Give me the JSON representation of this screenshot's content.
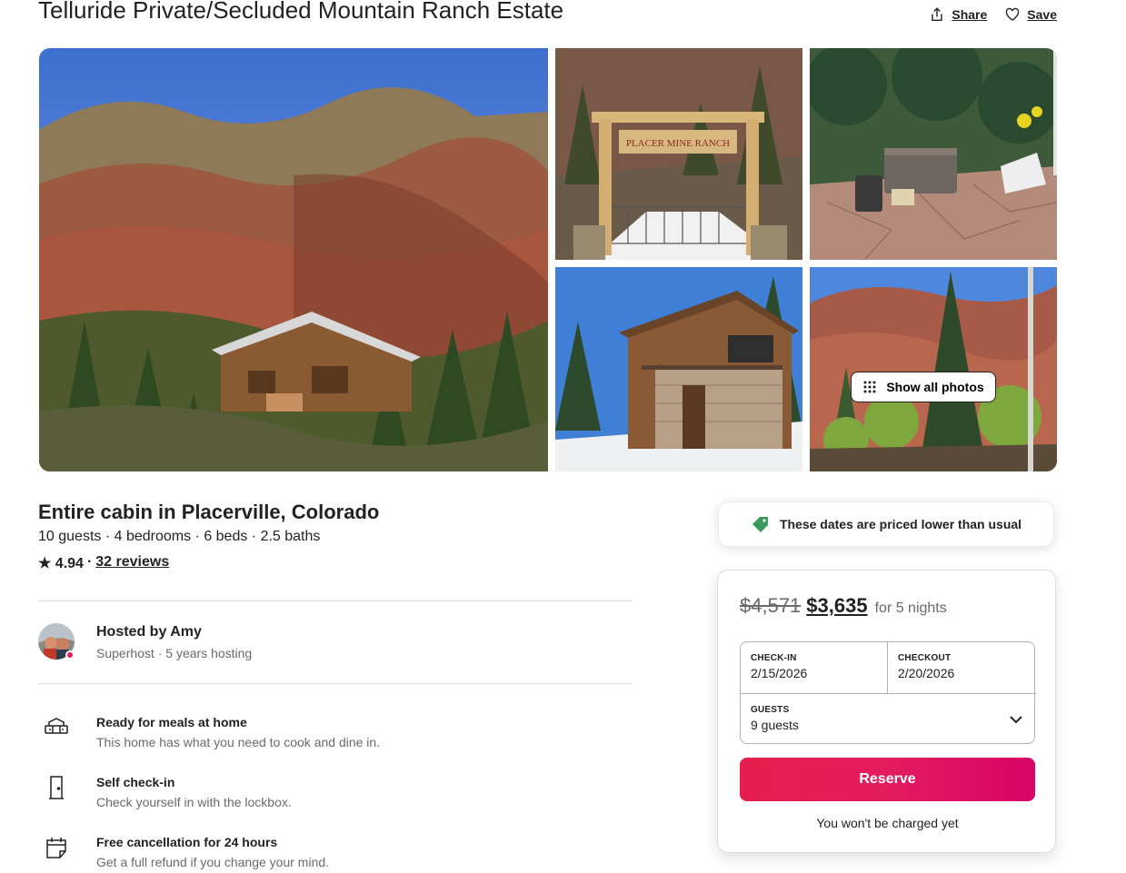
{
  "header": {
    "title": "Telluride Private/Secluded Mountain Ranch Estate",
    "share_label": "Share",
    "save_label": "Save"
  },
  "gallery": {
    "show_all_label": "Show all photos",
    "gate_sign_text": "PLACER MINE RANCH"
  },
  "overview": {
    "listing_type": "Entire cabin in Placerville, Colorado",
    "facts": "10 guests · 4 bedrooms · 6 beds · 2.5 baths",
    "rating": "★ 4.94",
    "rating_separator": "·",
    "reviews_label": "32 reviews"
  },
  "host": {
    "hosted_by": "Hosted by Amy",
    "subtitle": "Superhost · 5 years hosting"
  },
  "highlights": [
    {
      "icon": "kitchen-icon",
      "title": "Ready for meals at home",
      "desc": "This home has what you need to cook and dine in."
    },
    {
      "icon": "door-icon",
      "title": "Self check-in",
      "desc": "Check yourself in with the lockbox."
    },
    {
      "icon": "calendar-icon",
      "title": "Free cancellation for 24 hours",
      "desc": "Get a full refund if you change your mind."
    }
  ],
  "price_notice": {
    "text": "These dates are priced lower than usual"
  },
  "booking": {
    "original_price": "$4,571",
    "current_price": "$3,635",
    "nights_label": "for 5 nights",
    "checkin_label": "CHECK-IN",
    "checkin_value": "2/15/2026",
    "checkout_label": "CHECKOUT",
    "checkout_value": "2/20/2026",
    "guests_label": "GUESTS",
    "guests_value": "9 guests",
    "reserve_label": "Reserve",
    "no_charge_note": "You won't be charged yet"
  },
  "colors": {
    "brand": "#e31c5f",
    "text": "#222222",
    "muted": "#6a6a6a",
    "divider": "#dddddd",
    "price_tag": "#3a9a5b"
  }
}
